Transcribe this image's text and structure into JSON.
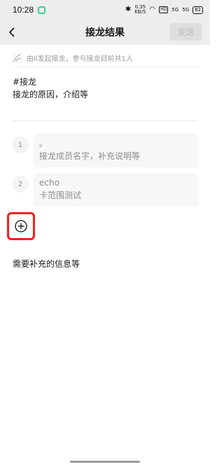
{
  "status_bar": {
    "time": "10:28",
    "speed_value": "0.35",
    "speed_unit": "KB/S",
    "hd_label": "HD",
    "network_1": "5G",
    "network_2": "5G",
    "battery": "82"
  },
  "header": {
    "title": "接龙结果",
    "send_label": "发送"
  },
  "initiator": {
    "text": "由ll发起接龙，参与接龙目前共1人"
  },
  "topic": {
    "title": "#接龙",
    "description": "接龙的原因，介绍等"
  },
  "entries": [
    {
      "number": "1",
      "line1": "。",
      "line2": "接龙成员名字，补充说明等"
    },
    {
      "number": "2",
      "line1": "echo",
      "line2": "卡范围测试"
    }
  ],
  "extra_info": "需要补充的信息等",
  "colors": {
    "accent_highlight": "#ff1a1a",
    "header_bg": "#ededed",
    "app_icon": "#3dcc8c"
  },
  "icons": [
    "back-icon",
    "add-icon",
    "avatar",
    "bluetooth-icon",
    "wifi-icon",
    "battery-icon"
  ]
}
